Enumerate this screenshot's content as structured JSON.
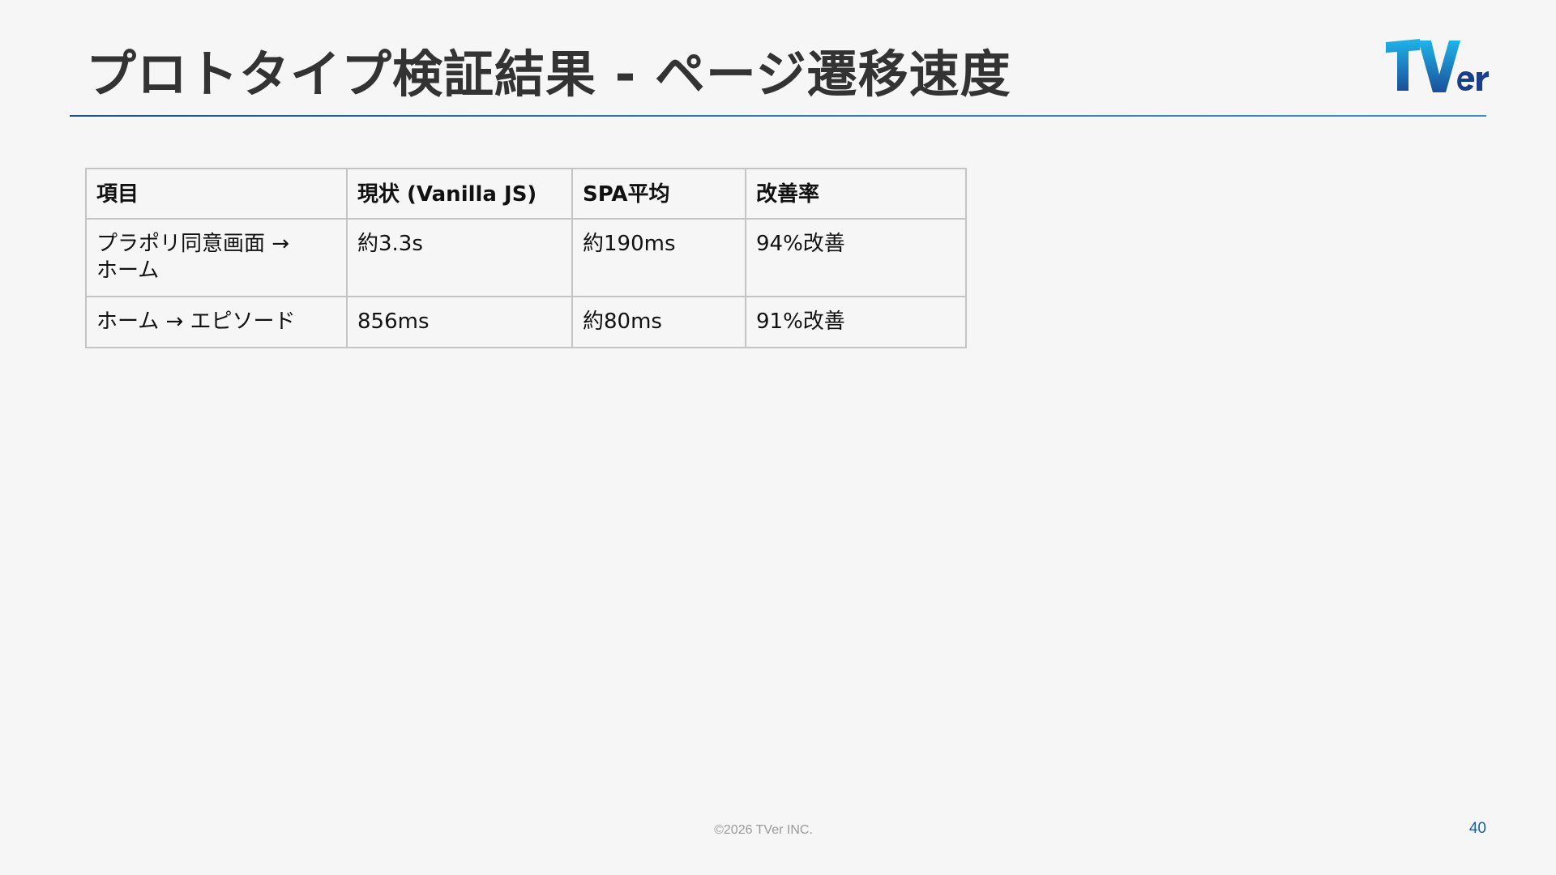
{
  "slide": {
    "title": "プロトタイプ検証結果 - ページ遷移速度",
    "logo_text": "TVer",
    "brand_colors": {
      "accent_blue": "#1a5fa8",
      "logo_cyan": "#1aa3e0",
      "logo_navy": "#1a3f8a"
    }
  },
  "table": {
    "headers": [
      "項目",
      "現状 (Vanilla JS)",
      "SPA平均",
      "改善率"
    ],
    "rows": [
      [
        "プラポリ同意画面 →\nホーム",
        "約3.3s",
        "約190ms",
        "94%改善"
      ],
      [
        "ホーム → エピソード",
        "856ms",
        "約80ms",
        "91%改善"
      ]
    ]
  },
  "footer": {
    "copyright": "©2026 TVer INC.",
    "page_number": "40"
  }
}
